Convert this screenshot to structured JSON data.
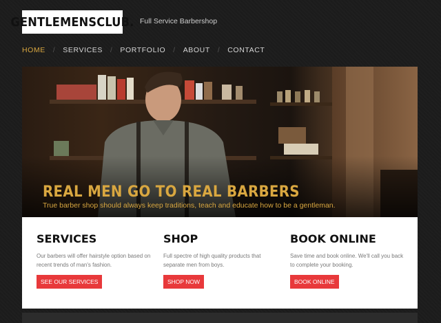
{
  "header": {
    "logo_text": "GENTLEMENSCLUB.",
    "tagline": "Full Service Barbershop"
  },
  "nav": {
    "items": [
      "HOME",
      "SERVICES",
      "PORTFOLIO",
      "ABOUT",
      "CONTACT"
    ],
    "separator": "/",
    "active": "HOME"
  },
  "hero": {
    "title": "REAL MEN GO TO REAL BARBERS",
    "subtitle": "True barber shop should always keep traditions, teach and educate how to be a gentleman."
  },
  "features": [
    {
      "title": "SERVICES",
      "text": "Our barbers will offer hairstyle option based on recent trends of man's fashion.",
      "button": "SEE OUR SERVICES"
    },
    {
      "title": "SHOP",
      "text": "Full spectre of high quality products that separate men from boys.",
      "button": "SHOP NOW"
    },
    {
      "title": "BOOK ONLINE",
      "text": "Save time and book online. We'll call you back to complete your booking.",
      "button": "BOOK ONLINE"
    }
  ],
  "colors": {
    "accent": "#d9a740",
    "button": "#e8393b",
    "background": "#1c1c1c"
  }
}
